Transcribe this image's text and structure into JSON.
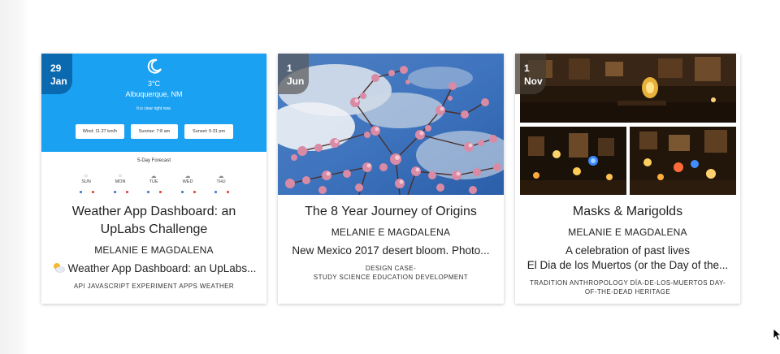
{
  "cards": [
    {
      "date_day": "29",
      "date_month": "Jan",
      "title": "Weather App Dashboard: an UpLabs Challenge",
      "author": "MELANIE E MAGDALENA",
      "excerpt_icon": "partly-sunny-icon",
      "excerpt": "Weather App Dashboard: an UpLabs...",
      "tags": "API  JAVASCRIPT  EXPERIMENT  APPS  WEATHER",
      "thumbnail": {
        "temp": "3°C",
        "city": "Albuquerque, NM",
        "condition": "It is clear right now.",
        "wind": "Wind: 11.27 km/h",
        "sunrise": "Sunrise: 7:8 am",
        "sunset": "Sunset: 5:31 pm",
        "forecast_title": "5-Day Forecast",
        "days": [
          "SUN",
          "MON",
          "TUE",
          "WED",
          "THU"
        ]
      }
    },
    {
      "date_day": "1",
      "date_month": "Jun",
      "title": "The 8 Year Journey of Origins",
      "author": "MELANIE E MAGDALENA",
      "excerpt": "New Mexico 2017 desert bloom. Photo...",
      "tags_line1": "DESIGN  CASE-",
      "tags_line2": "STUDY  SCIENCE  EDUCATION  DEVELOPMENT"
    },
    {
      "date_day": "1",
      "date_month": "Nov",
      "title": "Masks & Marigolds",
      "author": "MELANIE E MAGDALENA",
      "excerpt_line1": "A celebration of past lives",
      "excerpt_line2": "El Dia de los Muertos (or the Day of the...",
      "tags_line1": "TRADITION  ANTHROPOLOGY  DÍA-DE-LOS-MUERTOS  DAY-",
      "tags_line2": "OF-THE-DEAD  HERITAGE"
    }
  ],
  "colors": {
    "weather_blue": "#1aa1f2",
    "card_shadow": "#d0d0d0"
  }
}
